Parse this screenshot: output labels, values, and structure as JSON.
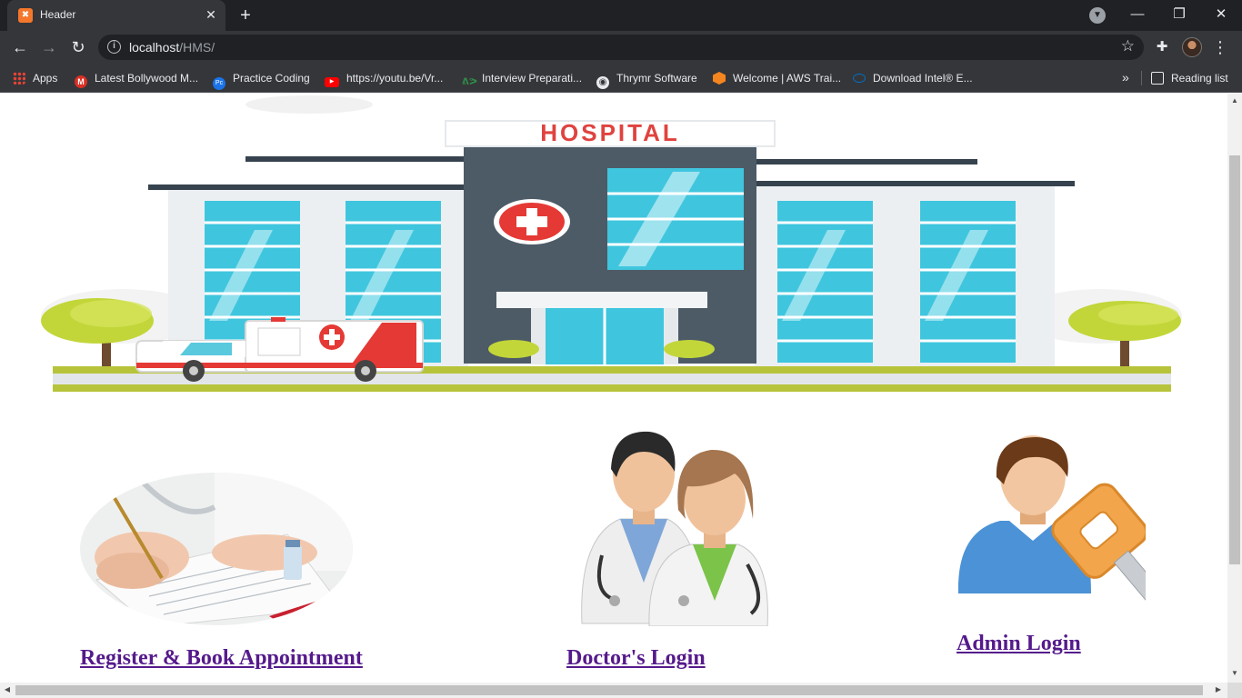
{
  "browser": {
    "tab_title": "Header",
    "tab_favicon": "xampp-icon",
    "new_tab_symbol": "+",
    "close_symbol": "✕",
    "url_host": "localhost",
    "url_path": "/HMS/",
    "info_symbol": "i",
    "bookmarks": [
      {
        "label": "Apps",
        "icon": "apps-grid-icon",
        "color": "#ea4335"
      },
      {
        "label": "Latest Bollywood M...",
        "icon": "m-icon",
        "color": "#d93025"
      },
      {
        "label": "Practice Coding",
        "icon": "pc-icon",
        "color": "#1a73e8"
      },
      {
        "label": "https://youtu.be/Vr...",
        "icon": "youtube-icon",
        "color": "#ff0000"
      },
      {
        "label": "Interview Preparati...",
        "icon": "gfg-icon",
        "color": "#2f8d46"
      },
      {
        "label": "Thrymr Software",
        "icon": "globe-icon",
        "color": "#e8eaed"
      },
      {
        "label": "Welcome | AWS Trai...",
        "icon": "aws-icon",
        "color": "#f5851f"
      },
      {
        "label": "Download Intel® E...",
        "icon": "intel-icon",
        "color": "#0071c5"
      }
    ],
    "overflow_symbol": "»",
    "reading_list_label": "Reading list"
  },
  "hero": {
    "sign_text": "HOSPITAL"
  },
  "tiles": [
    {
      "label": "Register & Book Appointment",
      "image": "medical-form-photo"
    },
    {
      "label": "Doctor's Login",
      "image": "doctors-illustration"
    },
    {
      "label": "Admin Login",
      "image": "admin-key-illustration"
    }
  ],
  "colors": {
    "link": "#551a8b",
    "chrome_dark": "#202124",
    "chrome_mid": "#35363a",
    "hospital_teal": "#39c2da",
    "hospital_dark": "#4d5b67",
    "red_cross": "#e53935",
    "tree_green": "#c2d63a"
  }
}
